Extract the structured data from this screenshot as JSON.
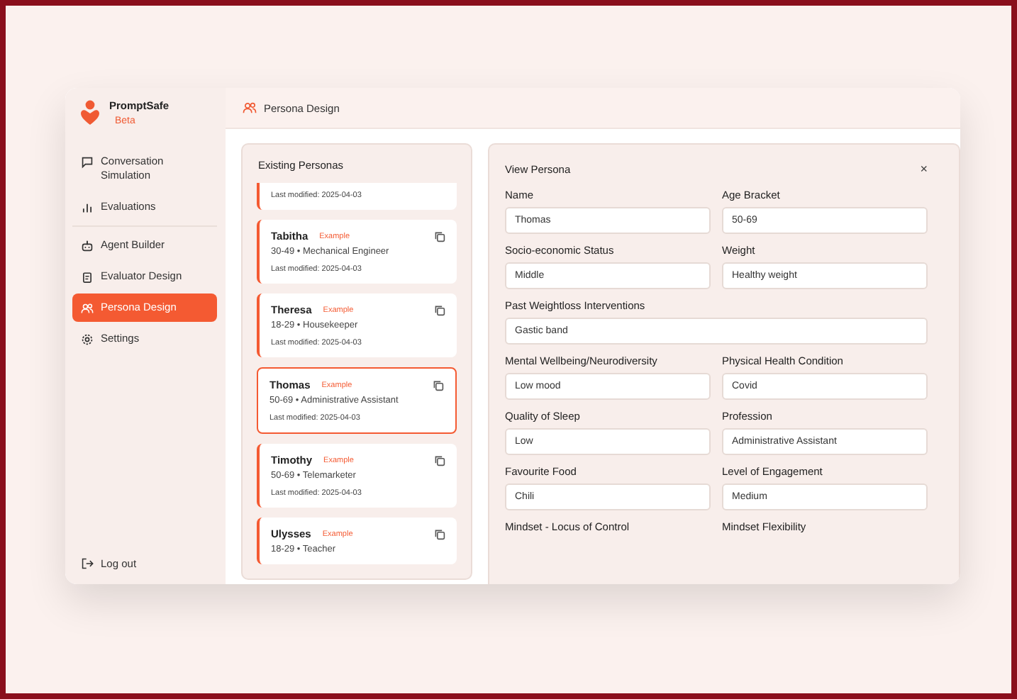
{
  "brand": {
    "name": "PromptSafe",
    "badge": "Beta"
  },
  "sidebar": {
    "groups": [
      [
        {
          "label": "Conversation Simulation",
          "kind": "chat",
          "selected": false
        },
        {
          "label": "Evaluations",
          "kind": "bars",
          "selected": false
        }
      ],
      [
        {
          "label": "Agent Builder",
          "kind": "robot",
          "selected": false
        },
        {
          "label": "Evaluator Design",
          "kind": "clipboard",
          "selected": false
        },
        {
          "label": "Persona Design",
          "kind": "people",
          "selected": true
        },
        {
          "label": "Settings",
          "kind": "gear",
          "selected": false
        }
      ]
    ],
    "logout": "Log out"
  },
  "header": {
    "title": "Persona Design"
  },
  "personas": {
    "title": "Existing Personas",
    "partial_card": {
      "modified": "Last modified: 2025-04-03"
    },
    "items": [
      {
        "name": "Tabitha",
        "tag": "Example",
        "subtitle": "30-49 • Mechanical Engineer",
        "modified": "Last modified: 2025-04-03",
        "selected": false
      },
      {
        "name": "Theresa",
        "tag": "Example",
        "subtitle": "18-29 • Housekeeper",
        "modified": "Last modified: 2025-04-03",
        "selected": false
      },
      {
        "name": "Thomas",
        "tag": "Example",
        "subtitle": "50-69 • Administrative Assistant",
        "modified": "Last modified: 2025-04-03",
        "selected": true
      },
      {
        "name": "Timothy",
        "tag": "Example",
        "subtitle": "50-69 • Telemarketer",
        "modified": "Last modified: 2025-04-03",
        "selected": false
      },
      {
        "name": "Ulysses",
        "tag": "Example",
        "subtitle": "18-29 • Teacher",
        "selected": false
      }
    ]
  },
  "view": {
    "title": "View Persona",
    "close": "×",
    "fields": [
      {
        "label": "Name",
        "value": "Thomas",
        "kind": "half"
      },
      {
        "label": "Age Bracket",
        "value": "50-69",
        "kind": "half"
      },
      {
        "label": "Socio-economic Status",
        "value": "Middle",
        "kind": "half"
      },
      {
        "label": "Weight",
        "value": "Healthy weight",
        "kind": "half"
      },
      {
        "label": "Past Weightloss Interventions",
        "value": "Gastic band",
        "kind": "full"
      },
      {
        "label": "Mental Wellbeing/Neurodiversity",
        "value": "Low mood",
        "kind": "half"
      },
      {
        "label": "Physical Health Condition",
        "value": "Covid",
        "kind": "half"
      },
      {
        "label": "Quality of Sleep",
        "value": "Low",
        "kind": "half"
      },
      {
        "label": "Profession",
        "value": "Administrative Assistant",
        "kind": "half"
      },
      {
        "label": "Favourite Food",
        "value": "Chili",
        "kind": "half"
      },
      {
        "label": "Level of Engagement",
        "value": "Medium",
        "kind": "half"
      },
      {
        "label": "Mindset - Locus of Control",
        "kind": "half"
      },
      {
        "label": "Mindset Flexibility",
        "kind": "half"
      }
    ]
  }
}
